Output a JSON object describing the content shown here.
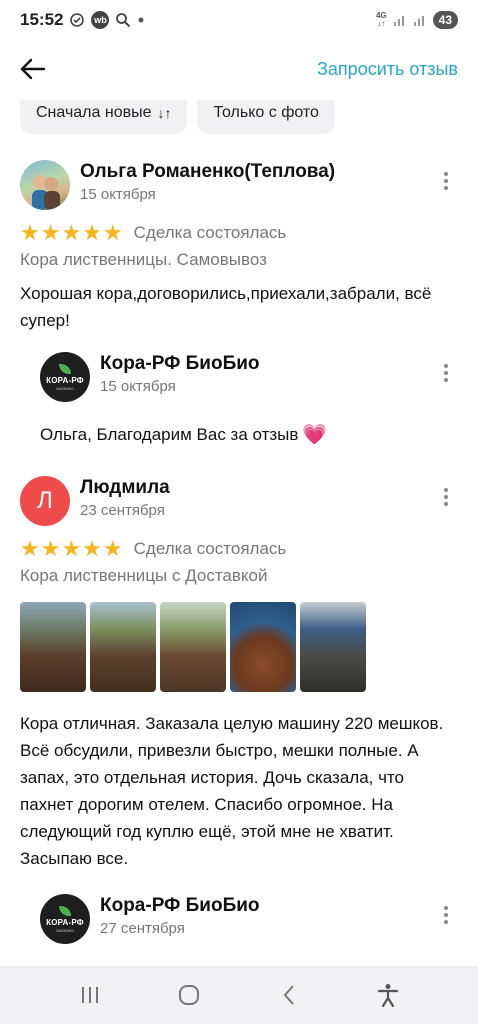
{
  "status_bar": {
    "time": "15:52",
    "wb_label": "wb",
    "network_top": "4G",
    "network_bottom": "↓↑",
    "battery": "43"
  },
  "header": {
    "request_review": "Запросить отзыв"
  },
  "filters": {
    "newest_first": "Сначала новые",
    "sort_icon": "↓↑",
    "only_with_photo": "Только с фото"
  },
  "reviews": [
    {
      "author": "Ольга Романенко(Теплова)",
      "date": "15 октября",
      "stars": "★★★★★",
      "rating": 5,
      "deal": "Сделка состоялась",
      "product": "Кора лиственницы. Самовывоз",
      "text": "Хорошая кора,договорились,приехали,забрали, всё супер!",
      "reply": {
        "author": "Кора-РФ БиоБио",
        "date": "15 октября",
        "logo_text": "КОРА-РФ",
        "logo_sub": "БИОБИО",
        "text": "Ольга, Благодарим Вас за отзыв",
        "emoji": "💗"
      }
    },
    {
      "author": "Людмила",
      "avatar_letter": "Л",
      "date": "23 сентября",
      "stars": "★★★★★",
      "rating": 5,
      "deal": "Сделка состоялась",
      "product": "Кора лиственницы с Доставкой",
      "text": "Кора отличная. Заказала целую машину 220 мешков. Всё обсудили, привезли быстро, мешки полные.  А запах, это  отдельная история. Дочь сказала, что пахнет дорогим отелем. Спасибо огромное.  На следующий год куплю ещё, этой мне не хватит. Засыпаю  все.",
      "reply": {
        "author": "Кора-РФ БиоБио",
        "date": "27 сентября",
        "logo_text": "КОРА-РФ",
        "logo_sub": "БИОБИО"
      }
    }
  ],
  "colors": {
    "accent": "#2aa5c8",
    "star": "#f6b51b",
    "avatar_red": "#ef4b4b"
  }
}
